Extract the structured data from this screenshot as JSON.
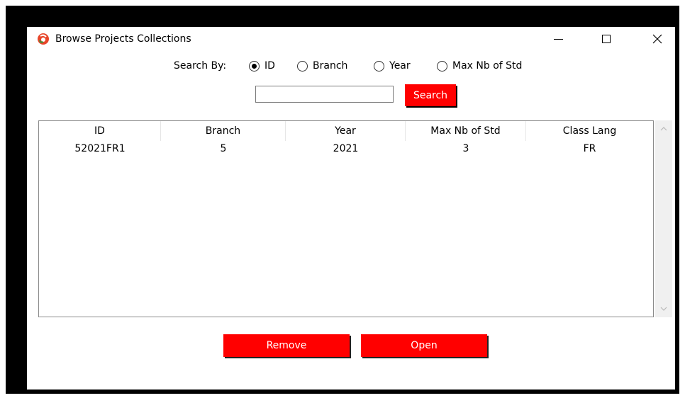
{
  "window": {
    "title": "Browse Projects Collections",
    "accent_color": "#ff0000"
  },
  "search": {
    "by_label": "Search By:",
    "options": [
      {
        "label": "ID",
        "checked": true
      },
      {
        "label": "Branch",
        "checked": false
      },
      {
        "label": "Year",
        "checked": false
      },
      {
        "label": "Max Nb of Std",
        "checked": false
      }
    ],
    "input_value": "",
    "button_label": "Search"
  },
  "table": {
    "columns": [
      "ID",
      "Branch",
      "Year",
      "Max Nb of Std",
      "Class Lang"
    ],
    "rows": [
      [
        "52021FR1",
        "5",
        "2021",
        "3",
        "FR"
      ]
    ]
  },
  "actions": {
    "remove_label": "Remove",
    "open_label": "Open"
  },
  "icons": {
    "app": "app-logo-icon",
    "minimize": "minimize-icon",
    "maximize": "maximize-icon",
    "close": "close-icon",
    "scroll_up": "chevron-up-icon",
    "scroll_down": "chevron-down-icon"
  }
}
